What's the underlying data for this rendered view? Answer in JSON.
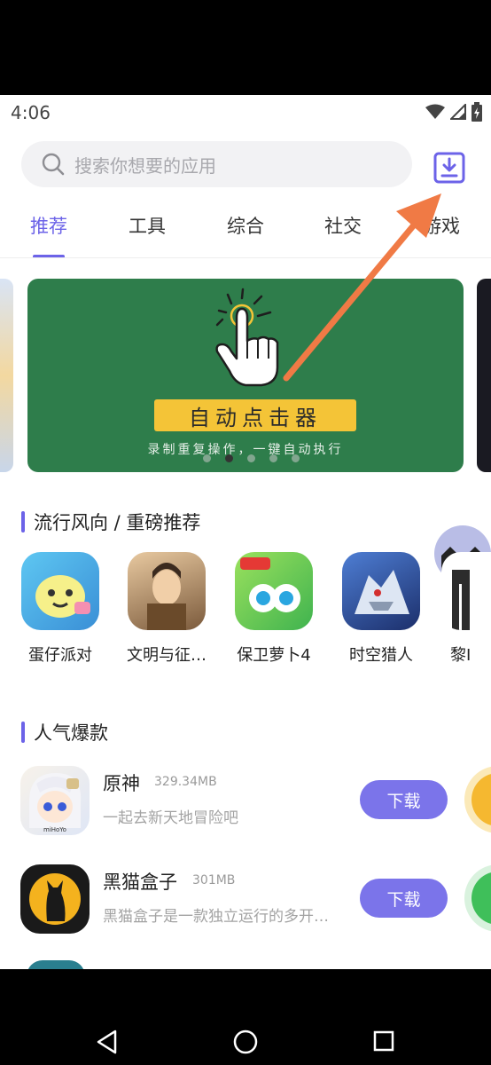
{
  "status_bar": {
    "time": "4:06"
  },
  "search": {
    "placeholder": "搜索你想要的应用"
  },
  "tabs": [
    {
      "label": "推荐",
      "active": true
    },
    {
      "label": "工具"
    },
    {
      "label": "综合"
    },
    {
      "label": "社交"
    },
    {
      "label": "游戏"
    }
  ],
  "banner": {
    "title": "自动点击器",
    "subtitle": "录制重复操作，一键自动执行",
    "slide_count": 5,
    "active_slide": 2
  },
  "trending": {
    "title": "流行风向 / 重磅推荐",
    "apps": [
      {
        "name": "蛋仔派对"
      },
      {
        "name": "文明与征…"
      },
      {
        "name": "保卫萝卜4"
      },
      {
        "name": "时空猎人"
      },
      {
        "name": "黎I"
      }
    ]
  },
  "popular": {
    "title": "人气爆款",
    "items": [
      {
        "name": "原神",
        "size": "329.34MB",
        "desc": "一起去新天地冒险吧",
        "button": "下载"
      },
      {
        "name": "黑猫盒子",
        "size": "301MB",
        "desc": "黑猫盒子是一款独立运行的多开…",
        "button": "下载"
      }
    ]
  },
  "colors": {
    "accent": "#6c63e8",
    "button": "#7b74ea",
    "banner_bg": "#2e7d4b",
    "arrow": "#f07a45"
  }
}
